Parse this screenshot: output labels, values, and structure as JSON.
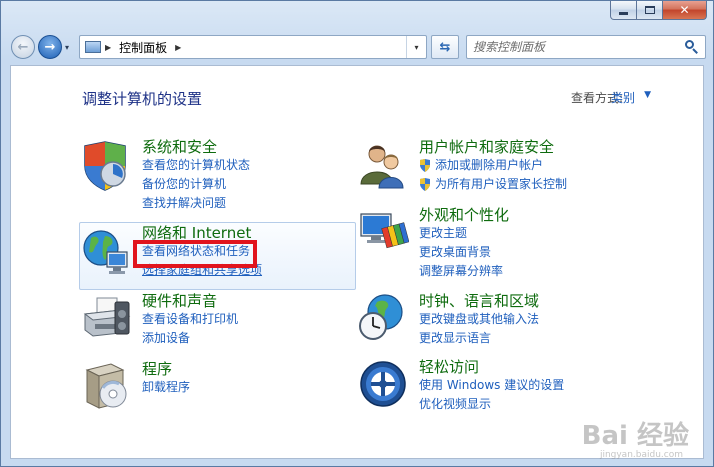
{
  "titlebar": {
    "close_glyph": "✕"
  },
  "nav": {
    "back_glyph": "←",
    "forward_glyph": "→",
    "dropdown_glyph": "▾"
  },
  "address": {
    "separator": "▶",
    "path": "控制面板",
    "trailing_separator": "▶",
    "dropdown_glyph": "▾"
  },
  "refresh_glyph": "⇆",
  "search": {
    "placeholder": "搜索控制面板"
  },
  "header": {
    "title": "调整计算机的设置",
    "view_by_label": "查看方式:",
    "view_by_value": "类别",
    "view_by_arrow": "▼"
  },
  "categories": {
    "system": {
      "title": "系统和安全",
      "links": [
        "查看您的计算机状态",
        "备份您的计算机",
        "查找并解决问题"
      ]
    },
    "network": {
      "title": "网络和 Internet",
      "links": [
        "查看网络状态和任务",
        "选择家庭组和共享选项"
      ]
    },
    "hardware": {
      "title": "硬件和声音",
      "links": [
        "查看设备和打印机",
        "添加设备"
      ]
    },
    "programs": {
      "title": "程序",
      "links": [
        "卸载程序"
      ]
    },
    "users": {
      "title": "用户帐户和家庭安全",
      "links": [
        "添加或删除用户帐户",
        "为所有用户设置家长控制"
      ]
    },
    "appearance": {
      "title": "外观和个性化",
      "links": [
        "更改主题",
        "更改桌面背景",
        "调整屏幕分辨率"
      ]
    },
    "clock": {
      "title": "时钟、语言和区域",
      "links": [
        "更改键盘或其他输入法",
        "更改显示语言"
      ]
    },
    "ease": {
      "title": "轻松访问",
      "links": [
        "使用 Windows 建议的设置",
        "优化视频显示"
      ]
    }
  },
  "watermark": {
    "brand": "Bai 经验",
    "url": "jingyan.baidu.com"
  },
  "colors": {
    "link": "#1f5fbd",
    "category_title": "#0e6b0e",
    "highlight": "#e1141d"
  }
}
